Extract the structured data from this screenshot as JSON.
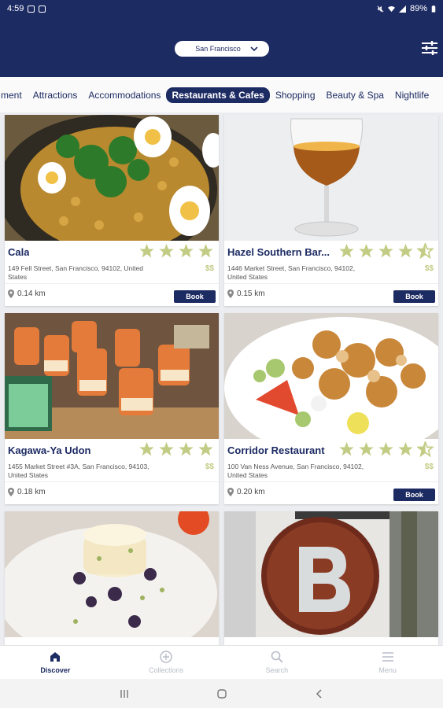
{
  "status_bar": {
    "time": "4:59",
    "battery": "89%"
  },
  "header": {
    "city": "San Francisco"
  },
  "categories": [
    {
      "label": "ment",
      "active": false
    },
    {
      "label": "Attractions",
      "active": false
    },
    {
      "label": "Accommodations",
      "active": false
    },
    {
      "label": "Restaurants & Cafes",
      "active": true
    },
    {
      "label": "Shopping",
      "active": false
    },
    {
      "label": "Beauty & Spa",
      "active": false
    },
    {
      "label": "Nightlife",
      "active": false
    }
  ],
  "cards": [
    {
      "name": "Cala",
      "address": "149 Fell Street, San Francisco, 94102, United States",
      "price": "$$",
      "distance": "0.14 km",
      "rating": 4,
      "book": "Book"
    },
    {
      "name": "Hazel Southern Bar...",
      "address": "1446 Market Street, San Francisco, 94102, United States",
      "price": "$$",
      "distance": "0.15 km",
      "rating": 4.5,
      "book": "Book"
    },
    {
      "name": "Kagawa-Ya Udon",
      "address": "1455 Market Street #3A, San Francisco, 94103, United States",
      "price": "$$",
      "distance": "0.18 km",
      "rating": 4,
      "book": null
    },
    {
      "name": "Corridor Restaurant",
      "address": "100 Van Ness Avenue, San Francisco, 94102, United States",
      "price": "$$",
      "distance": "0.20 km",
      "rating": 4.5,
      "book": "Book"
    },
    {
      "name": "",
      "address": "",
      "price": "",
      "distance": "",
      "rating": 0,
      "book": null
    },
    {
      "name": "",
      "address": "",
      "price": "",
      "distance": "",
      "rating": 0,
      "book": null
    }
  ],
  "bottom_nav": [
    {
      "label": "Discover",
      "icon": "home-icon",
      "active": true
    },
    {
      "label": "Collections",
      "icon": "plus-circle-icon",
      "active": false
    },
    {
      "label": "Search",
      "icon": "search-icon",
      "active": false
    },
    {
      "label": "Menu",
      "icon": "menu-icon",
      "active": false
    }
  ],
  "colors": {
    "primary": "#1d2b63",
    "star": "#c3cc84",
    "background": "#ecedf1"
  }
}
